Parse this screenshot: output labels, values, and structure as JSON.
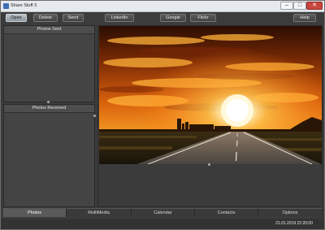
{
  "window": {
    "title": "Share Stuff 3",
    "controls": {
      "minimize": "–",
      "maximize": "□",
      "close": "✕"
    }
  },
  "toolbar": {
    "open": "Open",
    "delete": "Delete",
    "send": "Send",
    "linkedin": "LinkedIn",
    "google": "Google",
    "flickr": "Flickr",
    "help": "Help"
  },
  "panels": {
    "photos_sent": "Photos Sent",
    "photos_received": "Photos Received"
  },
  "tabs": [
    "Photos",
    "MultiMedia",
    "Calendar",
    "Contacts",
    "Options"
  ],
  "active_tab": "Photos",
  "status": {
    "datetime": "21.01.2019  22:20:00"
  },
  "icons": {
    "app": "share-app-icon"
  },
  "colors": {
    "window_bg": "#3c3c3c",
    "active_button": "#9aa3aa"
  }
}
